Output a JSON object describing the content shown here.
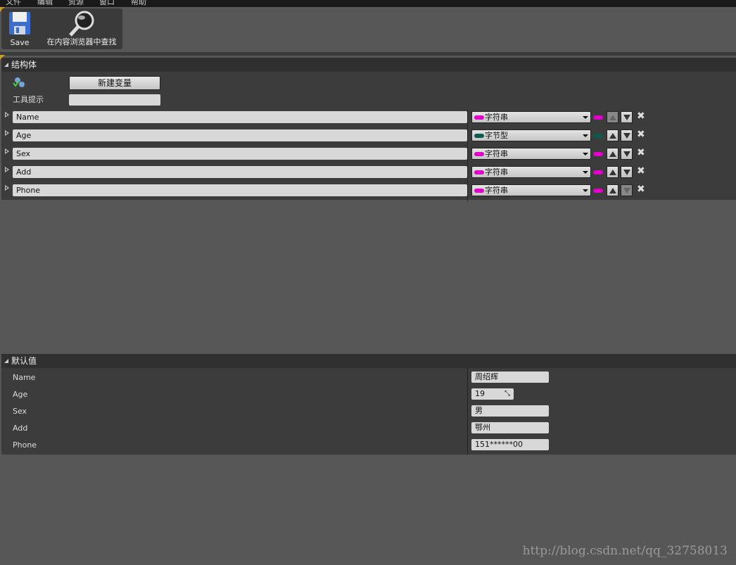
{
  "menu": [
    "文件",
    "编辑",
    "资源",
    "窗口",
    "帮助"
  ],
  "toolbar": {
    "save_label": "Save",
    "find_label": "在内容浏览器中查找"
  },
  "struct_panel": {
    "title": "结构体",
    "new_variable_label": "新建变量",
    "tooltip_label": "工具提示",
    "tooltip_value": "",
    "variables": [
      {
        "name": "Name",
        "type": "字符串",
        "color": "#e000c8",
        "can_up": false,
        "can_down": true
      },
      {
        "name": "Age",
        "type": "字节型",
        "color": "#0a5a50",
        "can_up": true,
        "can_down": true
      },
      {
        "name": "Sex",
        "type": "字符串",
        "color": "#e000c8",
        "can_up": true,
        "can_down": true
      },
      {
        "name": "Add",
        "type": "字符串",
        "color": "#e000c8",
        "can_up": true,
        "can_down": true
      },
      {
        "name": "Phone",
        "type": "字符串",
        "color": "#e000c8",
        "can_up": true,
        "can_down": false
      }
    ]
  },
  "defaults_panel": {
    "title": "默认值",
    "rows": [
      {
        "label": "Name",
        "value": "周绍辉"
      },
      {
        "label": "Age",
        "value": "19"
      },
      {
        "label": "Sex",
        "value": "男"
      },
      {
        "label": "Add",
        "value": "鄂州"
      },
      {
        "label": "Phone",
        "value": "151******00"
      }
    ]
  },
  "watermark": "http://blog.csdn.net/qq_32758013"
}
